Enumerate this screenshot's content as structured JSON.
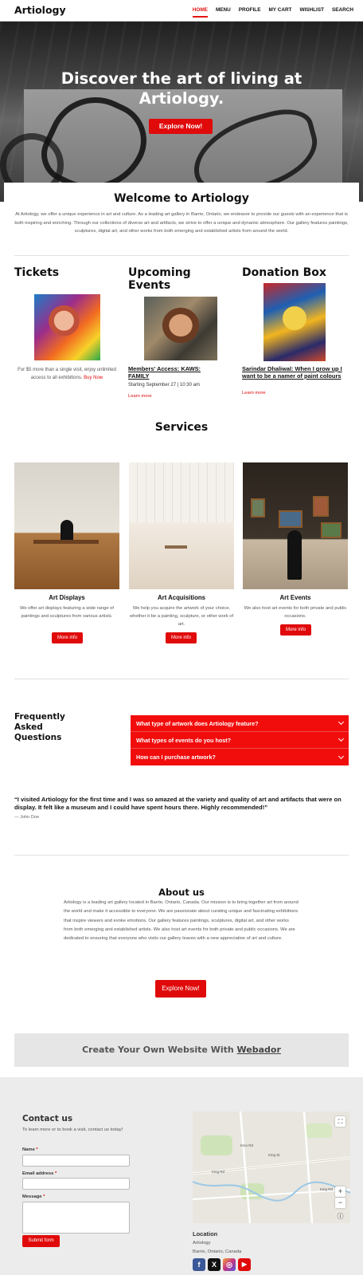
{
  "header": {
    "logo": "Artiology",
    "nav": [
      "HOME",
      "MENU",
      "PROFILE",
      "MY CART",
      "WISHLIST",
      "SEARCH"
    ]
  },
  "hero": {
    "title_line1": "Discover the art of living at",
    "title_line2": "Artiology.",
    "button": "Explore Now!"
  },
  "welcome": {
    "title": "Welcome to Artiology",
    "text": "At Artiology, we offer a unique experience in art and culture. As a leading art gallery in Barrie, Ontario, we endeavor to provide our guests with an experience that is both inspiring and enriching. Through our collections of diverse art and artifacts, we strive to offer a unique and dynamic atmosphere. Our gallery features paintings, sculptures, digital art, and other works from both emerging and established artists from around the world."
  },
  "tickets": {
    "title": "Tickets",
    "text": "For $5 more than a single visit, enjoy unlimited access to all exhibitions.",
    "link": "Buy Now"
  },
  "events": {
    "title": "Upcoming Events",
    "event_title": "Members' Access: KAWS: FAMILY",
    "date": "Starting September 27 | 10:30 am",
    "link": "Learn more"
  },
  "donation": {
    "title": "Donation Box",
    "event_title": "Sarindar Dhaliwal: When I grow up I want to be a namer of paint colours",
    "link": "Learn more"
  },
  "services": {
    "title": "Services",
    "items": [
      {
        "title": "Art Displays",
        "text": "We offer art displays featuring a wide range of paintings and sculptures from various artists.",
        "button": "More info"
      },
      {
        "title": "Art Acquisitions",
        "text": "We help you acquire the artwork of your choice, whether it be a painting, sculpture, or other work of art.",
        "button": "More info"
      },
      {
        "title": "Art Events",
        "text": "We also host art events for both private and public occasions.",
        "button": "More info"
      }
    ]
  },
  "faq": {
    "title_line1": "Frequently",
    "title_line2": "Asked",
    "title_line3": "Questions",
    "items": [
      "What type of artwork does Artiology feature?",
      "What types of events do you host?",
      "How can I purchase artwork?"
    ]
  },
  "testimonial": {
    "quote": "“I visited Artiology for the first time and I was so amazed at the variety and quality of art and artifacts that were on display. It felt like a museum and I could have spent hours there. Highly recommended!”",
    "author": "— John Doe"
  },
  "about": {
    "title": "About us",
    "text": "Artiology is a leading art gallery located in Barrie, Ontario, Canada. Our mission is to bring together art from around the world and make it accessible to everyone. We are passionate about curating unique and fascinating exhibitions that inspire viewers and evoke emotions. Our gallery features paintings, sculptures, digital art, and other works from both emerging and established artists. We also host art events for both private and public occasions. We are dedicated to ensuring that everyone who visits our gallery leaves with a new appreciation of art and culture.",
    "button": "Explore Now!"
  },
  "webador": {
    "text": "Create Your Own Website With ",
    "link": "Webador"
  },
  "contact": {
    "title": "Contact us",
    "subtitle": "To learn more or to book a visit, contact us today!",
    "name_label": "Name",
    "email_label": "Email address",
    "message_label": "Message",
    "required": "*",
    "submit": "Submit form"
  },
  "map": {
    "labels": [
      "King Rd",
      "King St",
      "Kino Rd",
      "King Rd"
    ],
    "zoom_in": "+",
    "zoom_out": "−"
  },
  "location": {
    "title": "Location",
    "name": "Artiology",
    "address": "Barrie, Ontario, Canada"
  },
  "social": [
    {
      "name": "facebook",
      "glyph": "f",
      "color": "#3b5998"
    },
    {
      "name": "x",
      "glyph": "X",
      "color": "#111111"
    },
    {
      "name": "instagram",
      "glyph": "◎",
      "color": "#c13584"
    },
    {
      "name": "youtube",
      "glyph": "▶",
      "color": "#e00a0a"
    }
  ],
  "colors": {
    "accent": "#e00a0a",
    "faq_bg": "#f20d0d"
  }
}
